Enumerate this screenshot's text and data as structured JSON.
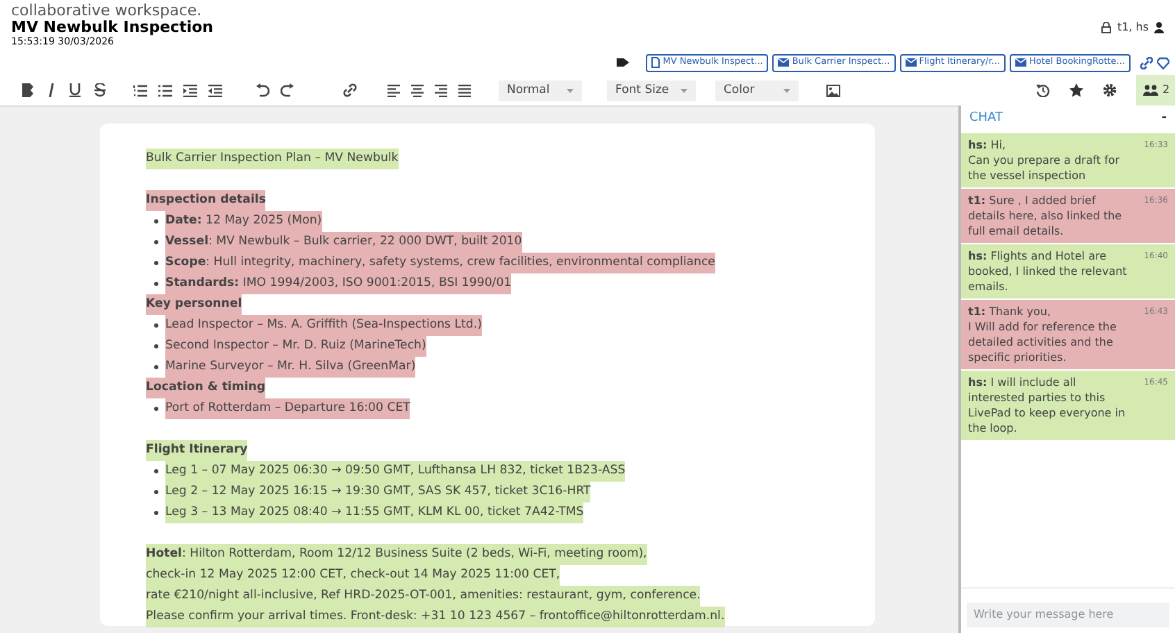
{
  "backdrop_caption": "collaborative workspace.",
  "document": {
    "title": "MV Newbulk Inspection",
    "timestamp": "15:53:19 30/03/2026",
    "users": "t1, hs"
  },
  "attachments": [
    {
      "kind": "doc",
      "label": "MV Newbulk Inspect..."
    },
    {
      "kind": "mail",
      "label": "Bulk Carrier Inspect..."
    },
    {
      "kind": "mail",
      "label": "Flight Itinerary/r..."
    },
    {
      "kind": "mail",
      "label": "Hotel BookingRotte..."
    }
  ],
  "toolbar": {
    "paragraph_style": "Normal",
    "font_size": "Font Size",
    "color_label": "Color",
    "participants": "2"
  },
  "blocks": [
    {
      "kind": "para",
      "color": "#d4eab0",
      "text": "Bulk Carrier Inspection Plan – MV Newbulk"
    },
    {
      "kind": "gap"
    },
    {
      "kind": "heading",
      "color": "#e6b3b5",
      "text": "Inspection details"
    },
    {
      "kind": "list",
      "color": "#e6b3b5",
      "items": [
        "**Date:** 12 May 2025 (Mon)",
        "**Vessel**: MV Newbulk – Bulk carrier, 22 000 DWT, built 2010",
        "**Scope**: Hull integrity, machinery, safety systems, crew facilities, environmental compliance",
        "**Standards:** IMO 1994/2003, ISO 9001:2015, BSI 1990/01"
      ]
    },
    {
      "kind": "heading",
      "color": "#e6b3b5",
      "text": "Key personnel"
    },
    {
      "kind": "list",
      "color": "#e6b3b5",
      "items": [
        "Lead Inspector – Ms. A. Griffith (Sea-Inspections Ltd.)",
        "Second Inspector – Mr. D. Ruiz (MarineTech)",
        "Marine Surveyor – Mr. H. Silva (GreenMar)"
      ]
    },
    {
      "kind": "heading",
      "color": "#e6b3b5",
      "text": "Location & timing"
    },
    {
      "kind": "list",
      "color": "#e6b3b5",
      "items": [
        "Port of Rotterdam – Departure 16:00 CET"
      ]
    },
    {
      "kind": "gap"
    },
    {
      "kind": "heading",
      "color": "#d4eab0",
      "text": "Flight Itinerary"
    },
    {
      "kind": "list",
      "color": "#d4eab0",
      "items": [
        "Leg 1 – 07 May 2025 06:30 → 09:50 GMT, Lufthansa LH 832, ticket 1B23-ASS",
        "Leg 2 – 12 May 2025 16:15 → 19:30 GMT, SAS SK 457, ticket 3C16-HRT",
        "Leg 3 – 13 May 2025 08:40 → 11:55 GMT, KLM KL 00, ticket 7A42-TMS"
      ]
    },
    {
      "kind": "gap"
    },
    {
      "kind": "lines",
      "color": "#d4eab0",
      "items": [
        "**Hotel**: Hilton Rotterdam, Room 12/12 Business Suite (2 beds, Wi-Fi, meeting room),",
        "check-in 12 May 2025 12:00 CET, check-out 14 May 2025 11:00 CET,",
        "rate €210/night all-inclusive, Ref HRD-2025-OT-001, amenities: restaurant, gym, conference.",
        "Please confirm your arrival times. Front-desk: +31 10 123 4567 – frontoffice@hiltonrotterdam.nl."
      ]
    }
  ],
  "chat": {
    "title": "CHAT",
    "collapse": "-",
    "placeholder": "Write your message here",
    "messages": [
      {
        "author": "hs:",
        "color": "#d4eab0",
        "text": "Hi,\nCan you prepare a draft for the vessel inspection",
        "time": "16:33"
      },
      {
        "author": "t1:",
        "color": "#e6b3b5",
        "text": "Sure , I added brief details here, also linked the full email details.",
        "time": "16:36"
      },
      {
        "author": "hs:",
        "color": "#d4eab0",
        "text": "Flights and Hotel are booked, I linked the relevant emails.",
        "time": "16:40"
      },
      {
        "author": "t1:",
        "color": "#e6b3b5",
        "text": "Thank you,\nI Will add for reference the detailed activities and the specific priorities.",
        "time": "16:43"
      },
      {
        "author": "hs:",
        "color": "#d4eab0",
        "text": "I will include all interested parties to this LivePad to keep everyone in the loop.",
        "time": "16:45"
      }
    ]
  }
}
